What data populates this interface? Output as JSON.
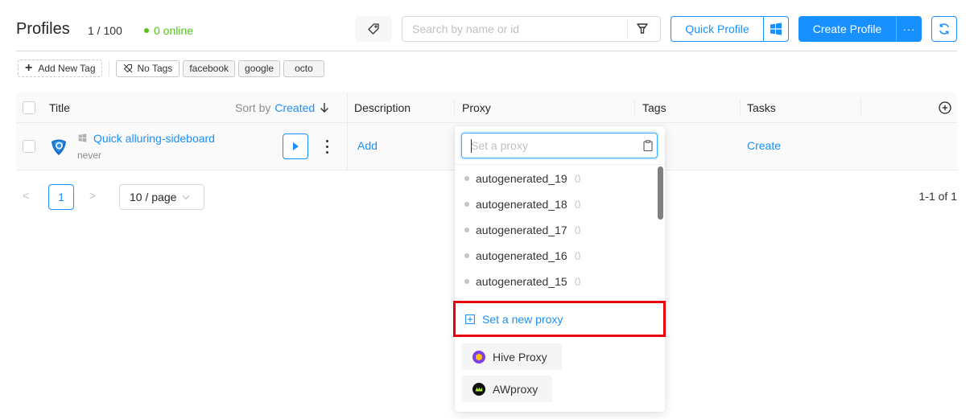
{
  "header": {
    "title": "Profiles",
    "count": "1 / 100",
    "online": "0 online",
    "search_placeholder": "Search by name or id",
    "quick_profile_label": "Quick Profile",
    "create_profile_label": "Create Profile",
    "more_label": "···"
  },
  "tags": {
    "add_label": "Add New Tag",
    "no_tags_label": "No Tags",
    "items": [
      "facebook",
      "google",
      "octo"
    ]
  },
  "table": {
    "columns": {
      "title": "Title",
      "sort_by": "Sort by",
      "sort_field": "Created",
      "description": "Description",
      "proxy": "Proxy",
      "tags": "Tags",
      "tasks": "Tasks"
    },
    "rows": [
      {
        "name": "Quick alluring-sideboard",
        "last_run": "never",
        "description_action": "Add",
        "tasks_action": "Create"
      }
    ]
  },
  "pagination": {
    "prev": "<",
    "current": "1",
    "next": ">",
    "page_size": "10 / page",
    "total": "1-1 of 1"
  },
  "proxy_dropdown": {
    "placeholder": "Set a proxy",
    "items": [
      {
        "name": "autogenerated_19",
        "count": "0"
      },
      {
        "name": "autogenerated_18",
        "count": "0"
      },
      {
        "name": "autogenerated_17",
        "count": "0"
      },
      {
        "name": "autogenerated_16",
        "count": "0"
      },
      {
        "name": "autogenerated_15",
        "count": "0"
      }
    ],
    "new_proxy_label": "Set a new proxy",
    "providers": [
      {
        "name": "Hive Proxy",
        "color": "#7b3fe4",
        "accent": "#ffc107"
      },
      {
        "name": "AWproxy",
        "color": "#111111",
        "accent": "#b6f23a"
      }
    ]
  },
  "colors": {
    "accent": "#1890ff",
    "online": "#52c41a",
    "highlight": "#e8000c"
  }
}
